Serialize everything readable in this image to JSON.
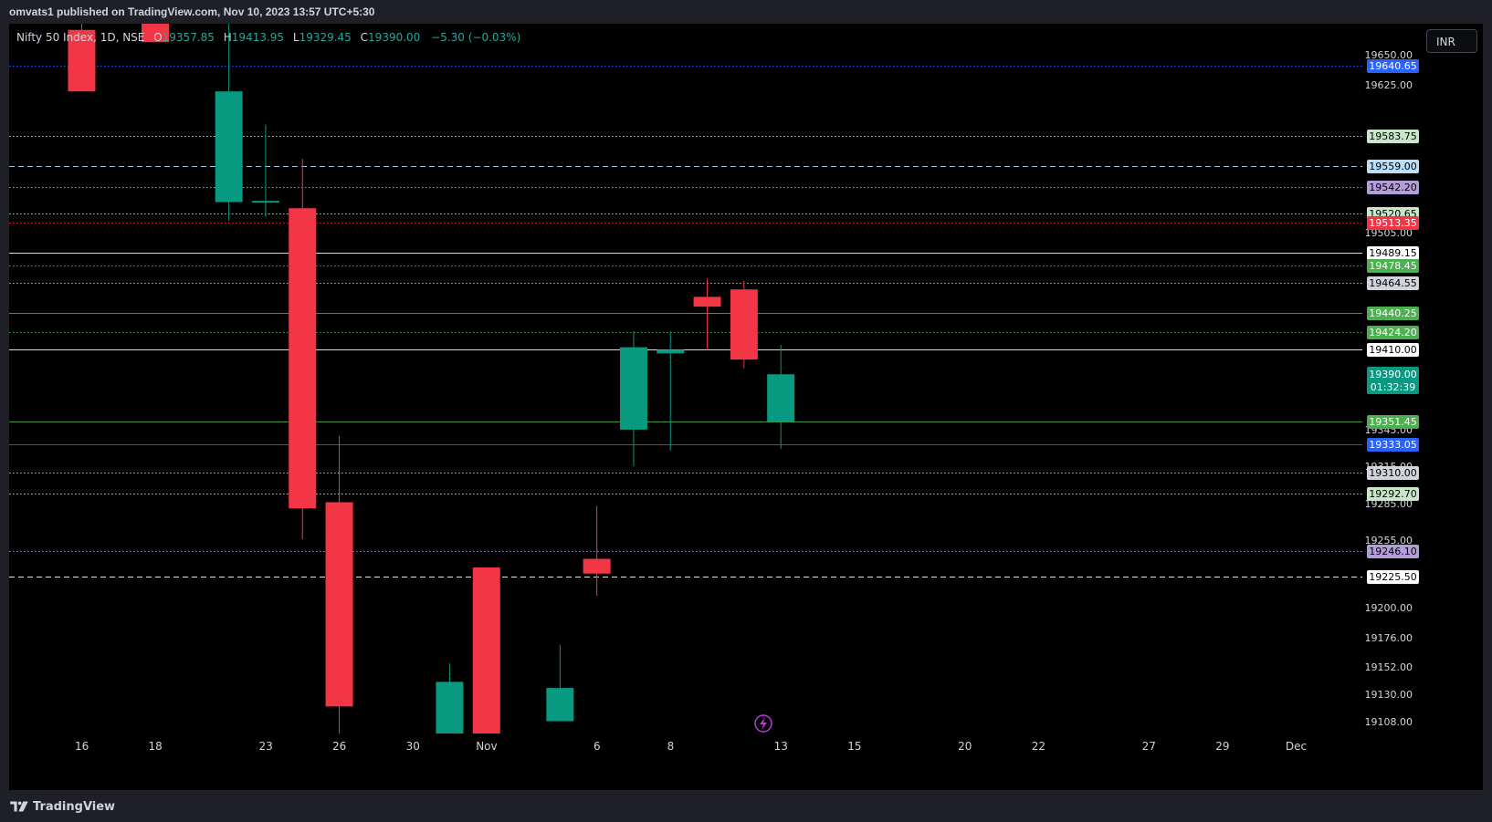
{
  "header": {
    "publish_line": "omvats1 published on TradingView.com, Nov 10, 2023 13:57 UTC+5:30"
  },
  "legend": {
    "symbol": "Nifty 50 Index, 1D, NSE",
    "o_label": "O",
    "o_value": "19357.85",
    "h_label": "H",
    "h_value": "19413.95",
    "l_label": "L",
    "l_value": "19329.45",
    "c_label": "C",
    "c_value": "19390.00",
    "change": "−5.30 (−0.03%)"
  },
  "currency": "INR",
  "footer": {
    "brand": "TradingView"
  },
  "colors": {
    "up": "#089981",
    "down": "#f23645",
    "background": "#000000"
  },
  "chart_data": {
    "type": "candlestick",
    "timeframe": "1D",
    "ylim": [
      19098,
      19675
    ],
    "price_ticks": [
      "19650.00",
      "19625.00",
      "19505.00",
      "19345.00",
      "19315.00",
      "19285.00",
      "19255.00",
      "19200.00",
      "19176.00",
      "19152.00",
      "19130.00",
      "19108.00"
    ],
    "x_labels": [
      "16",
      "18",
      "23",
      "26",
      "30",
      "Nov",
      "6",
      "8",
      "13",
      "15",
      "20",
      "22",
      "27",
      "29",
      "Dec"
    ],
    "candles": [
      {
        "slot": 1.5,
        "open": 19670,
        "high": 19675,
        "low": 19637,
        "close": 19620
      },
      {
        "slot": 3.5,
        "open": 19675,
        "high": 19675,
        "low": 19665,
        "close": 19660
      },
      {
        "slot": 5.5,
        "open": 19530,
        "high": 19675,
        "low": 19515,
        "close": 19620
      },
      {
        "slot": 6.5,
        "open": 19530,
        "high": 19593,
        "low": 19518,
        "close": 19531
      },
      {
        "slot": 7.5,
        "open": 19525,
        "high": 19565,
        "low": 19256,
        "close": 19281
      },
      {
        "slot": 8.5,
        "open": 19286,
        "high": 19340,
        "low": 19098,
        "close": 19120
      },
      {
        "slot": 11.5,
        "open": 19098,
        "high": 19155,
        "low": 19098,
        "close": 19140
      },
      {
        "slot": 12.5,
        "open": 19233,
        "high": 19233,
        "low": 19098,
        "close": 19098
      },
      {
        "slot": 14.5,
        "open": 19108,
        "high": 19170,
        "low": 19108,
        "close": 19135
      },
      {
        "slot": 15.5,
        "open": 19240,
        "high": 19283,
        "low": 19210,
        "close": 19228
      },
      {
        "slot": 16.5,
        "open": 19345,
        "high": 19425,
        "low": 19315,
        "close": 19412
      },
      {
        "slot": 17.5,
        "open": 19407,
        "high": 19425,
        "low": 19328,
        "close": 19410
      },
      {
        "slot": 18.5,
        "open": 19453,
        "high": 19468,
        "low": 19410,
        "close": 19445
      },
      {
        "slot": 19.5,
        "open": 19459,
        "high": 19466,
        "low": 19395,
        "close": 19402
      },
      {
        "slot": 20.5,
        "open": 19351.45,
        "high": 19413.95,
        "low": 19329.45,
        "close": 19390.0
      }
    ],
    "horizontal_levels": [
      {
        "price": 19640.65,
        "label": "19640.65",
        "color": "#2962ff",
        "text": "#ffffff",
        "style": "dotted"
      },
      {
        "price": 19583.75,
        "label": "19583.75",
        "color": "#c8e6c9",
        "text": "#000000",
        "style": "dotted"
      },
      {
        "price": 19559.0,
        "label": "19559.00",
        "color": "#bbdefb",
        "text": "#000000",
        "style": "dashed"
      },
      {
        "price": 19542.2,
        "label": "19542.20",
        "color": "#b39ddb",
        "text": "#000000",
        "style": "dotted"
      },
      {
        "price": 19520.65,
        "label": "19520.65",
        "color": "#c8e6c9",
        "text": "#000000",
        "style": "dotted"
      },
      {
        "price": 19513.35,
        "label": "19513.35",
        "color": "#f23645",
        "text": "#ffffff",
        "style": "dotted"
      },
      {
        "price": 19489.15,
        "label": "19489.15",
        "color": "#ffffff",
        "text": "#000000",
        "style": "solid"
      },
      {
        "price": 19478.45,
        "label": "19478.45",
        "color": "#4caf50",
        "text": "#ffffff",
        "style": "dotted"
      },
      {
        "price": 19464.55,
        "label": "19464.55",
        "color": "#d1d4dc",
        "text": "#000000",
        "style": "dotted"
      },
      {
        "price": 19440.25,
        "label": "19440.25",
        "color": "#4caf50",
        "text": "#ffffff",
        "style": "solid"
      },
      {
        "price": 19424.2,
        "label": "19424.20",
        "color": "#4caf50",
        "text": "#ffffff",
        "style": "dotted"
      },
      {
        "price": 19410.0,
        "label": "19410.00",
        "color": "#ffffff",
        "text": "#000000",
        "style": "solid"
      },
      {
        "price": 19351.45,
        "label": "19351.45",
        "color": "#4caf50",
        "text": "#ffffff",
        "style": "solid"
      },
      {
        "price": 19333.05,
        "label": "19333.05",
        "color": "#2962ff",
        "text": "#ffffff",
        "style": "solid"
      },
      {
        "price": 19310.0,
        "label": "19310.00",
        "color": "#d1d4dc",
        "text": "#000000",
        "style": "dotted"
      },
      {
        "price": 19292.7,
        "label": "19292.70",
        "color": "#c8e6c9",
        "text": "#000000",
        "style": "dotted"
      },
      {
        "price": 19246.1,
        "label": "19246.10",
        "color": "#b39ddb",
        "text": "#000000",
        "style": "dotted"
      },
      {
        "price": 19225.5,
        "label": "19225.50",
        "color": "#ffffff",
        "text": "#000000",
        "style": "dashed"
      }
    ],
    "last_price": {
      "price": 19390.0,
      "label": "19390.00",
      "countdown": "01:32:39",
      "color": "#089981"
    }
  }
}
